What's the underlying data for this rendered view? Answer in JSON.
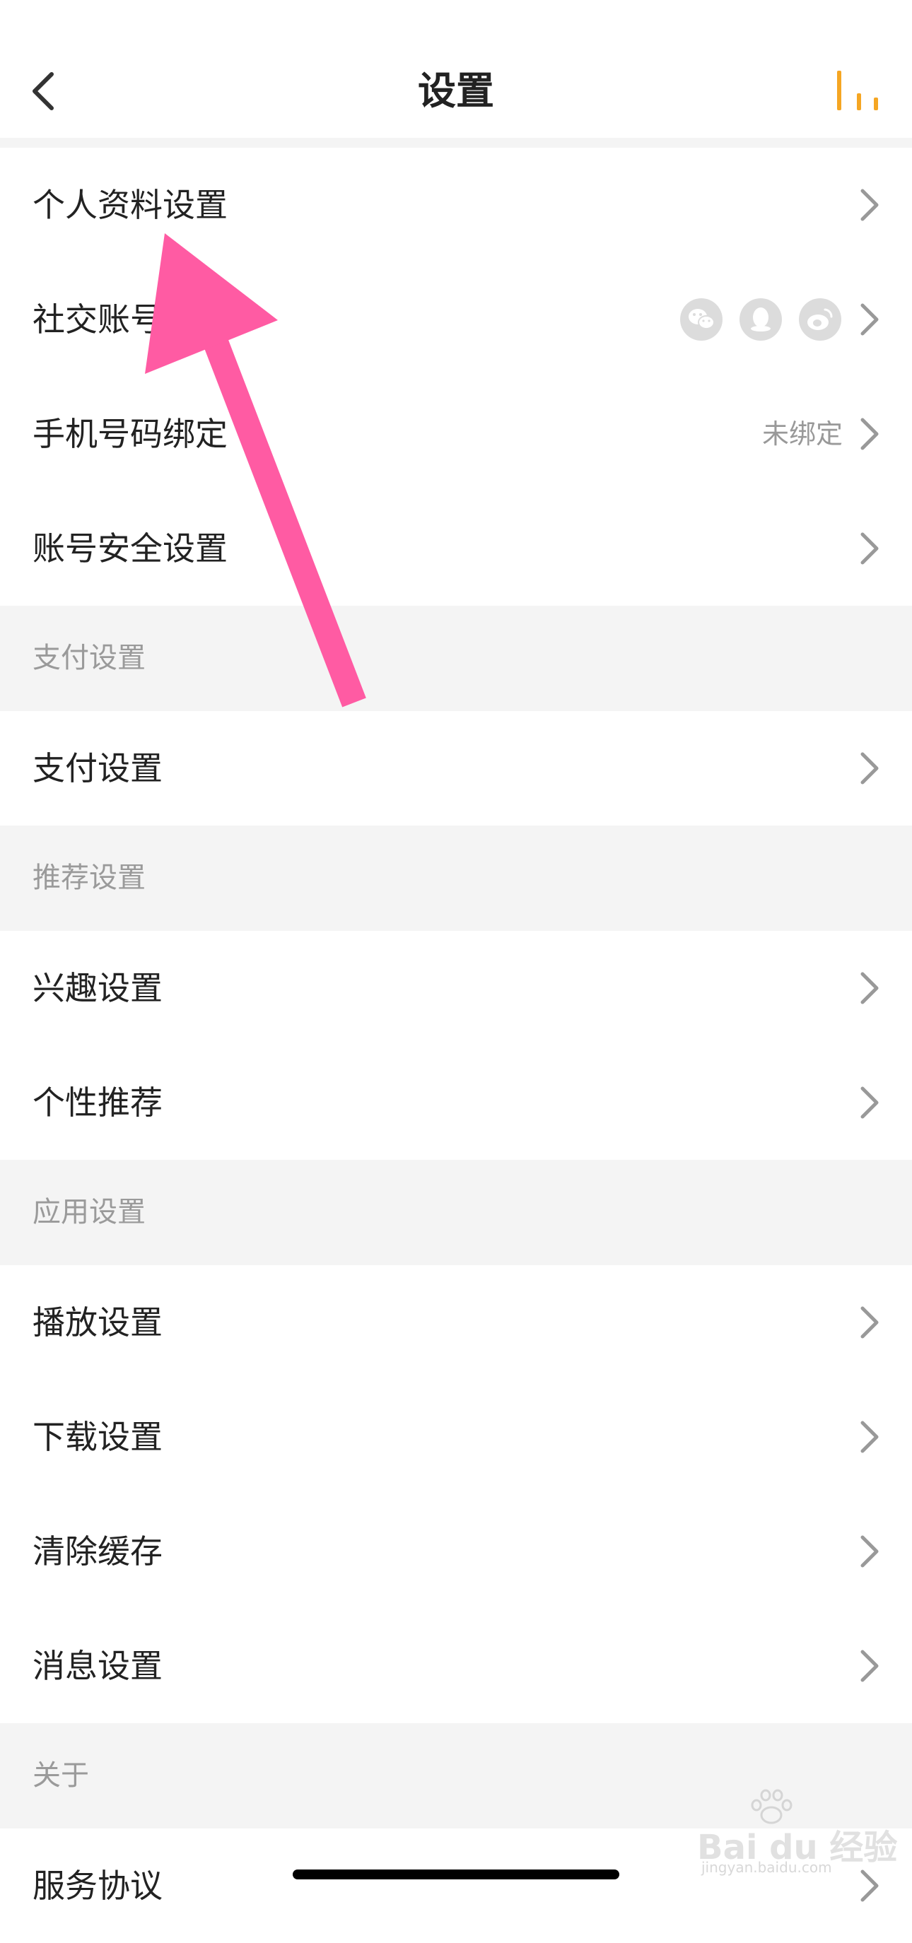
{
  "header": {
    "title": "设置",
    "back_icon": "chevron-left-icon",
    "right_icon": "bars-icon",
    "accent_color": "#F5A623"
  },
  "rows": {
    "profile": {
      "label": "个人资料设置"
    },
    "social": {
      "label": "社交账号",
      "icons": [
        "wechat-icon",
        "qq-icon",
        "weibo-icon"
      ]
    },
    "phone": {
      "label": "手机号码绑定",
      "value": "未绑定"
    },
    "security": {
      "label": "账号安全设置"
    },
    "payment": {
      "label": "支付设置"
    },
    "interest": {
      "label": "兴趣设置"
    },
    "personal_rec": {
      "label": "个性推荐"
    },
    "playback": {
      "label": "播放设置"
    },
    "download": {
      "label": "下载设置"
    },
    "clear_cache": {
      "label": "清除缓存"
    },
    "notifications": {
      "label": "消息设置"
    },
    "service_agreement": {
      "label": "服务协议"
    }
  },
  "sections": {
    "payment": "支付设置",
    "recommendation": "推荐设置",
    "app": "应用设置",
    "about": "关于"
  },
  "annotation": {
    "arrow_color": "#FF5BA3"
  },
  "watermark": {
    "brand": "Bai du 经验",
    "url": "jingyan.baidu.com"
  }
}
